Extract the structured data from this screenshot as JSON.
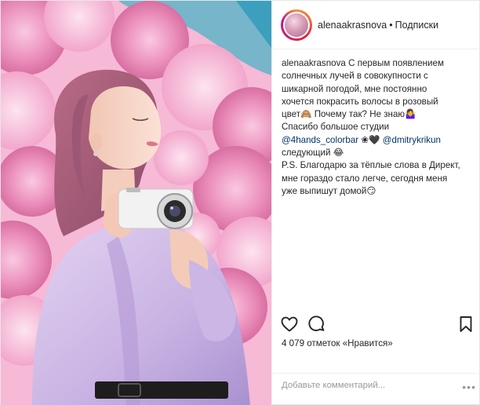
{
  "post": {
    "username": "alenaakrasnova",
    "separator": "•",
    "follow_label": "Подписки",
    "caption_lines": [
      "С первым появлением",
      "солнечных лучей в совокупности с",
      "шикарной погодой, мне постоянно",
      "хочется покрасить волосы в розовый",
      "цвет🙈 Почему так? Не знаю🤷‍♀️",
      "Спасибо большое студии",
      "@4hands_colorbar",
      " ❀🖤 ",
      "@dmitrykrikun",
      "следующий 😂",
      "P.S. Благодарю за тёплые слова в Директ,",
      "мне гораздо стало легче, сегодня меня",
      "уже выпишут домой😏"
    ],
    "likes_text": "4 079 отметок «Нравится»",
    "comment_placeholder": "Добавьте комментарий...",
    "more_label": "•••"
  },
  "icons": {
    "like": "heart-outline-icon",
    "comment": "comment-bubble-icon",
    "save": "bookmark-icon"
  },
  "colors": {
    "mention": "#003569",
    "text": "#262626",
    "muted": "#999999",
    "border": "#efefef"
  }
}
